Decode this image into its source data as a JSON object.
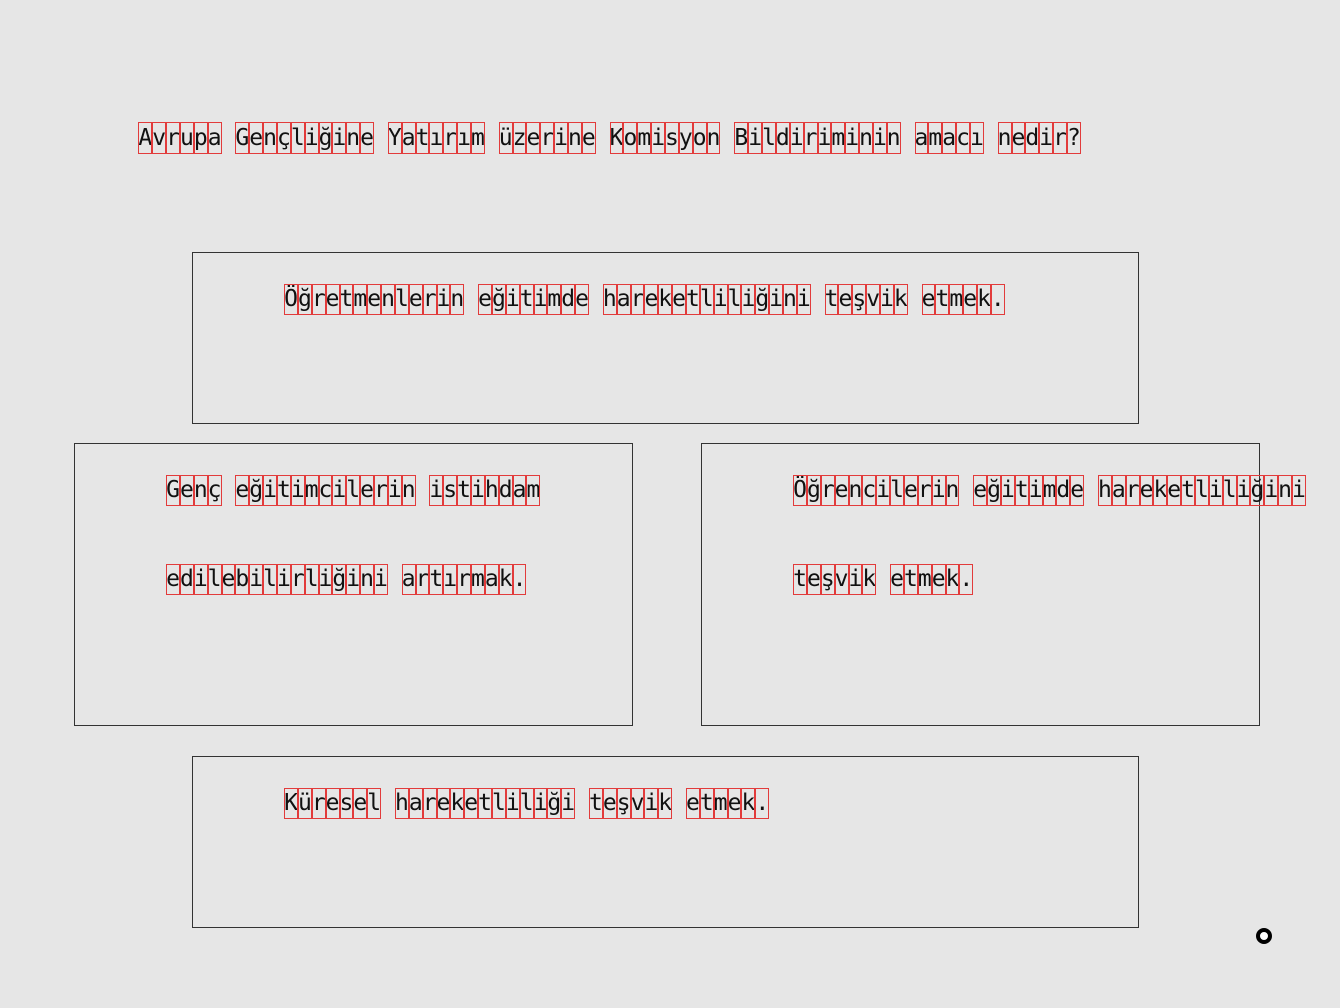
{
  "question": "Avrupa Gençliğine Yatırım üzerine Komisyon Bildiriminin amacı nedir?",
  "answers": [
    {
      "lines": [
        "Öğretmenlerin eğitimde hareketliliğini teşvik etmek."
      ]
    },
    {
      "lines": [
        "Genç eğitimcilerin istihdam",
        "edilebilirliğini artırmak."
      ]
    },
    {
      "lines": [
        "Öğrencilerin eğitimde hareketliliğini",
        "teşvik etmek."
      ]
    },
    {
      "lines": [
        "Küresel hareketliliği teşvik etmek."
      ]
    }
  ],
  "cursor": {
    "icon": "cursor-ring-icon"
  },
  "colors": {
    "background": "#e6e6e6",
    "text": "#111111",
    "box_border": "#333333",
    "char_outline": "#e23b3b"
  }
}
